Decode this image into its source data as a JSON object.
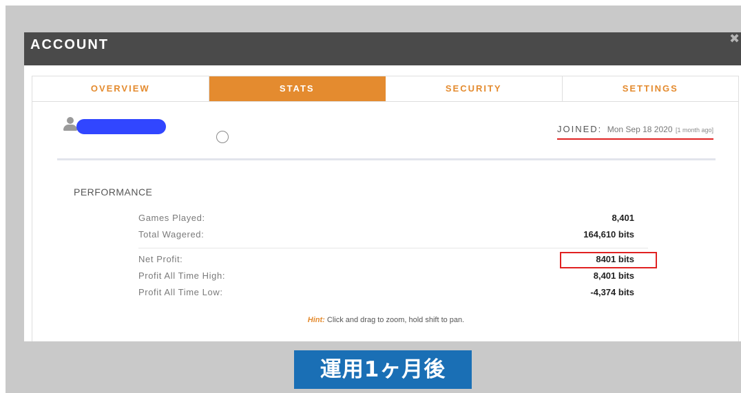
{
  "modal": {
    "title": "ACCOUNT",
    "close_icon": "close-icon"
  },
  "tabs": [
    {
      "label": "OVERVIEW",
      "active": false
    },
    {
      "label": "STATS",
      "active": true
    },
    {
      "label": "SECURITY",
      "active": false
    },
    {
      "label": "SETTINGS",
      "active": false
    }
  ],
  "profile": {
    "user_icon": "user-icon",
    "joined_label": "JOINED:",
    "joined_date": "Mon Sep 18 2020",
    "joined_relative": "[1 month ago]"
  },
  "performance": {
    "title": "PERFORMANCE",
    "stats": [
      {
        "label": "Games Played:",
        "value": "8,401"
      },
      {
        "label": "Total Wagered:",
        "value": "164,610 bits"
      },
      {
        "label": "Net Profit:",
        "value": "8401 bits"
      },
      {
        "label": "Profit All Time High:",
        "value": "8,401 bits"
      },
      {
        "label": "Profit All Time Low:",
        "value": "-4,374 bits"
      }
    ]
  },
  "hint": {
    "label": "Hint:",
    "text": " Click and drag to zoom, hold shift to pan."
  },
  "caption": "運用1ヶ月後",
  "colors": {
    "accent": "#e48b2f",
    "header": "#4a4a4a",
    "annotation": "#e02020",
    "caption_bg": "#1a6fb5",
    "redaction": "#3146ff"
  }
}
